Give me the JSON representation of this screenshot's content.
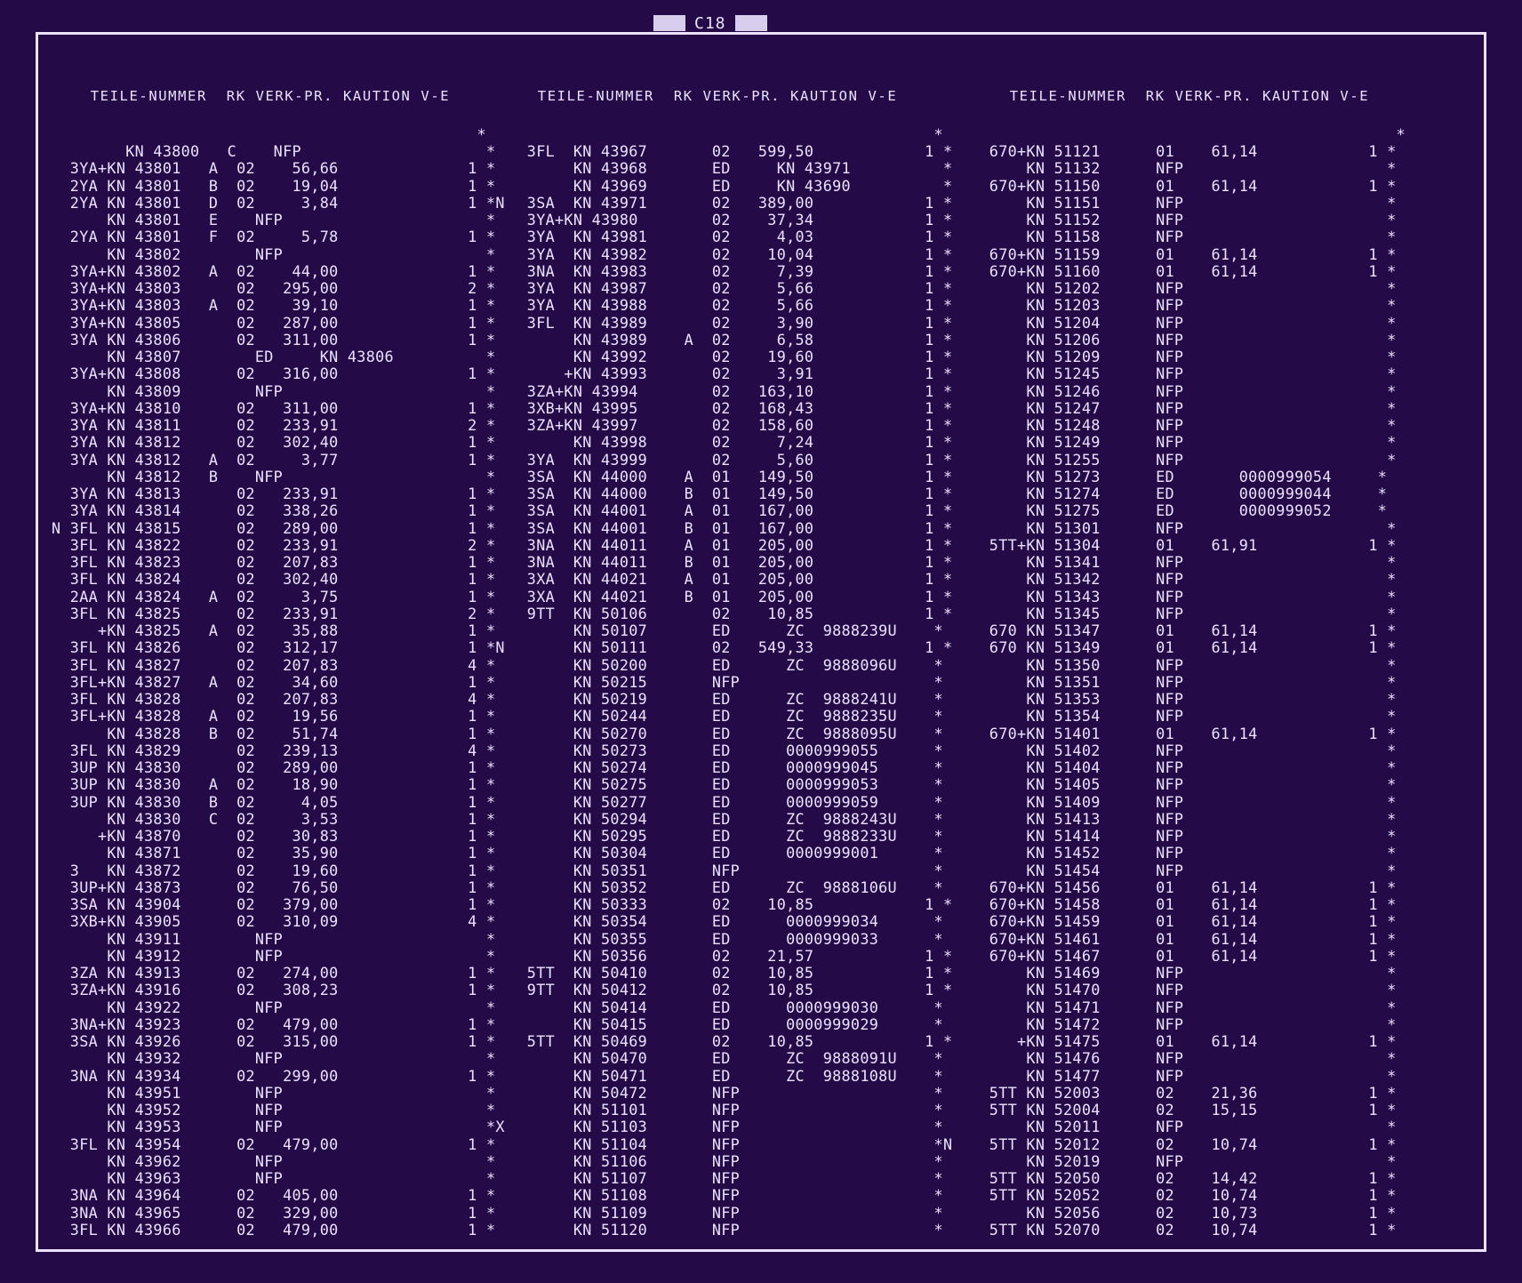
{
  "sheet": {
    "code": "C18"
  },
  "columns": [
    {
      "header": "    TEILE-NUMMER  RK VERK-PR. KAUTION V-E  ",
      "rows": [
        "                                              *",
        "        KN 43800   C    NFP                    *",
        "  3YA+KN 43801   A  02    56,66              1 *",
        "  2YA KN 43801   B  02    19,04              1 *",
        "  2YA KN 43801   D  02     3,84              1 *N",
        "      KN 43801   E    NFP                      *",
        "  2YA KN 43801   F  02     5,78              1 *",
        "      KN 43802        NFP                      *",
        "  3YA+KN 43802   A  02    44,00              1 *",
        "  3YA+KN 43803      02   295,00              2 *",
        "  3YA+KN 43803   A  02    39,10              1 *",
        "  3YA+KN 43805      02   287,00              1 *",
        "  3YA KN 43806      02   311,00              1 *",
        "      KN 43807        ED     KN 43806          *",
        "  3YA+KN 43808      02   316,00              1 *",
        "      KN 43809        NFP                      *",
        "  3YA+KN 43810      02   311,00              1 *",
        "  3YA KN 43811      02   233,91              2 *",
        "  3YA KN 43812      02   302,40              1 *",
        "  3YA KN 43812   A  02     3,77              1 *",
        "      KN 43812   B    NFP                      *",
        "  3YA KN 43813      02   233,91              1 *",
        "  3YA KN 43814      02   338,26              1 *",
        "N 3FL KN 43815      02   289,00              1 *",
        "  3FL KN 43822      02   233,91              2 *",
        "  3FL KN 43823      02   207,83              1 *",
        "  3FL KN 43824      02   302,40              1 *",
        "  2AA KN 43824   A  02     3,75              1 *",
        "  3FL KN 43825      02   233,91              2 *",
        "     +KN 43825   A  02    35,88              1 *",
        "  3FL KN 43826      02   312,17              1 *N",
        "  3FL KN 43827      02   207,83              4 *",
        "  3FL+KN 43827   A  02    34,60              1 *",
        "  3FL KN 43828      02   207,83              4 *",
        "  3FL+KN 43828   A  02    19,56              1 *",
        "      KN 43828   B  02    51,74              1 *",
        "  3FL KN 43829      02   239,13              4 *",
        "  3UP KN 43830      02   289,00              1 *",
        "  3UP KN 43830   A  02    18,90              1 *",
        "  3UP KN 43830   B  02     4,05              1 *",
        "      KN 43830   C  02     3,53              1 *",
        "     +KN 43870      02    30,83              1 *",
        "      KN 43871      02    35,90              1 *",
        "  3   KN 43872      02    19,60              1 *",
        "  3UP+KN 43873      02    76,50              1 *",
        "  3SA KN 43904      02   379,00              1 *",
        "  3XB+KN 43905      02   310,09              4 *",
        "      KN 43911        NFP                      *",
        "      KN 43912        NFP                      *",
        "  3ZA KN 43913      02   274,00              1 *",
        "  3ZA+KN 43916      02   308,23              1 *",
        "      KN 43922        NFP                      *",
        "  3NA+KN 43923      02   479,00              1 *",
        "  3SA KN 43926      02   315,00              1 *",
        "      KN 43932        NFP                      *",
        "  3NA KN 43934      02   299,00              1 *",
        "      KN 43951        NFP                      *",
        "      KN 43952        NFP                      *",
        "      KN 43953        NFP                      *X",
        "  3FL KN 43954      02   479,00              1 *",
        "      KN 43962        NFP                      *",
        "      KN 43963        NFP                      *",
        "  3NA KN 43964      02   405,00              1 *",
        "  3NA KN 43965      02   329,00              1 *",
        "  3FL KN 43966      02   479,00              1 *"
      ]
    },
    {
      "header": "   TEILE-NUMMER  RK VERK-PR. KAUTION V-E  ",
      "rows": [
        "                                              *",
        "  3FL  KN 43967       02   599,50            1 *",
        "       KN 43968       ED     KN 43971          *",
        "       KN 43969       ED     KN 43690          *",
        "  3SA  KN 43971       02   389,00            1 *",
        "  3YA+KN 43980        02    37,34            1 *",
        "  3YA  KN 43981       02     4,03            1 *",
        "  3YA  KN 43982       02    10,04            1 *",
        "  3NA  KN 43983       02     7,39            1 *",
        "  3YA  KN 43987       02     5,66            1 *",
        "  3YA  KN 43988       02     5,66            1 *",
        "  3FL  KN 43989       02     3,90            1 *",
        "       KN 43989    A  02     6,58            1 *",
        "       KN 43992       02    19,60            1 *",
        "      +KN 43993       02     3,91            1 *",
        "  3ZA+KN 43994        02   163,10            1 *",
        "  3XB+KN 43995        02   168,43            1 *",
        "  3ZA+KN 43997        02   158,60            1 *",
        "       KN 43998       02     7,24            1 *",
        "  3YA  KN 43999       02     5,60            1 *",
        "  3SA  KN 44000    A  01   149,50            1 *",
        "  3SA  KN 44000    B  01   149,50            1 *",
        "  3SA  KN 44001    A  01   167,00            1 *",
        "  3SA  KN 44001    B  01   167,00            1 *",
        "  3NA  KN 44011    A  01   205,00            1 *",
        "  3NA  KN 44011    B  01   205,00            1 *",
        "  3XA  KN 44021    A  01   205,00            1 *",
        "  3XA  KN 44021    B  01   205,00            1 *",
        "  9TT  KN 50106       02    10,85            1 *",
        "       KN 50107       ED      ZC  9888239U    *",
        "       KN 50111       02   549,33            1 *",
        "       KN 50200       ED      ZC  9888096U    *",
        "       KN 50215       NFP                     *",
        "       KN 50219       ED      ZC  9888241U    *",
        "       KN 50244       ED      ZC  9888235U    *",
        "       KN 50270       ED      ZC  9888095U    *",
        "       KN 50273       ED      0000999055      *",
        "       KN 50274       ED      0000999045      *",
        "       KN 50275       ED      0000999053      *",
        "       KN 50277       ED      0000999059      *",
        "       KN 50294       ED      ZC  9888243U    *",
        "       KN 50295       ED      ZC  9888233U    *",
        "       KN 50304       ED      0000999001      *",
        "       KN 50351       NFP                     *",
        "       KN 50352       ED      ZC  9888106U    *",
        "       KN 50333       02    10,85            1 *",
        "       KN 50354       ED      0000999034      *",
        "       KN 50355       ED      0000999033      *",
        "       KN 50356       02    21,57            1 *",
        "  5TT  KN 50410       02    10,85            1 *",
        "  9TT  KN 50412       02    10,85            1 *",
        "       KN 50414       ED      0000999030      *",
        "       KN 50415       ED      0000999029      *",
        "  5TT  KN 50469       02    10,85            1 *",
        "       KN 50470       ED      ZC  9888091U    *",
        "       KN 50471       ED      ZC  9888108U    *",
        "       KN 50472       NFP                     *",
        "       KN 51101       NFP                     *",
        "       KN 51103       NFP                     *",
        "       KN 51104       NFP                     *N",
        "       KN 51106       NFP                     *",
        "       KN 51107       NFP                     *",
        "       KN 51108       NFP                     *",
        "       KN 51109       NFP                     *",
        "       KN 51120       NFP                     *"
      ]
    },
    {
      "header": "    TEILE-NUMMER  RK VERK-PR. KAUTION V-E  ",
      "rows": [
        "                                              *",
        "  670+KN 51121      01    61,14            1 *",
        "      KN 51132      NFP                      *",
        "  670+KN 51150      01    61,14            1 *",
        "      KN 51151      NFP                      *",
        "      KN 51152      NFP                      *",
        "      KN 51158      NFP                      *",
        "  670+KN 51159      01    61,14            1 *",
        "  670+KN 51160      01    61,14            1 *",
        "      KN 51202      NFP                      *",
        "      KN 51203      NFP                      *",
        "      KN 51204      NFP                      *",
        "      KN 51206      NFP                      *",
        "      KN 51209      NFP                      *",
        "      KN 51245      NFP                      *",
        "      KN 51246      NFP                      *",
        "      KN 51247      NFP                      *",
        "      KN 51248      NFP                      *",
        "      KN 51249      NFP                      *",
        "      KN 51255      NFP                      *",
        "      KN 51273      ED       0000999054     *",
        "      KN 51274      ED       0000999044     *",
        "      KN 51275      ED       0000999052     *",
        "      KN 51301      NFP                      *",
        "  5TT+KN 51304      01    61,91            1 *",
        "      KN 51341      NFP                      *",
        "      KN 51342      NFP                      *",
        "      KN 51343      NFP                      *",
        "      KN 51345      NFP                      *",
        "  670 KN 51347      01    61,14            1 *",
        "  670 KN 51349      01    61,14            1 *",
        "      KN 51350      NFP                      *",
        "      KN 51351      NFP                      *",
        "      KN 51353      NFP                      *",
        "      KN 51354      NFP                      *",
        "  670+KN 51401      01    61,14            1 *",
        "      KN 51402      NFP                      *",
        "      KN 51404      NFP                      *",
        "      KN 51405      NFP                      *",
        "      KN 51409      NFP                      *",
        "      KN 51413      NFP                      *",
        "      KN 51414      NFP                      *",
        "      KN 51452      NFP                      *",
        "      KN 51454      NFP                      *",
        "  670+KN 51456      01    61,14            1 *",
        "  670+KN 51458      01    61,14            1 *",
        "  670+KN 51459      01    61,14            1 *",
        "  670+KN 51461      01    61,14            1 *",
        "  670+KN 51467      01    61,14            1 *",
        "      KN 51469      NFP                      *",
        "      KN 51470      NFP                      *",
        "      KN 51471      NFP                      *",
        "      KN 51472      NFP                      *",
        "     +KN 51475      01    61,14            1 *",
        "      KN 51476      NFP                      *",
        "      KN 51477      NFP                      *",
        "  5TT KN 52003      02    21,36            1 *",
        "  5TT KN 52004      02    15,15            1 *",
        "      KN 52011      NFP                      *",
        "  5TT KN 52012      02    10,74            1 *",
        "      KN 52019      NFP                      *",
        "  5TT KN 52050      02    14,42            1 *",
        "  5TT KN 52052      02    10,74            1 *",
        "      KN 52056      02    10,73            1 *",
        "  5TT KN 52070      02    10,74            1 *"
      ]
    }
  ]
}
